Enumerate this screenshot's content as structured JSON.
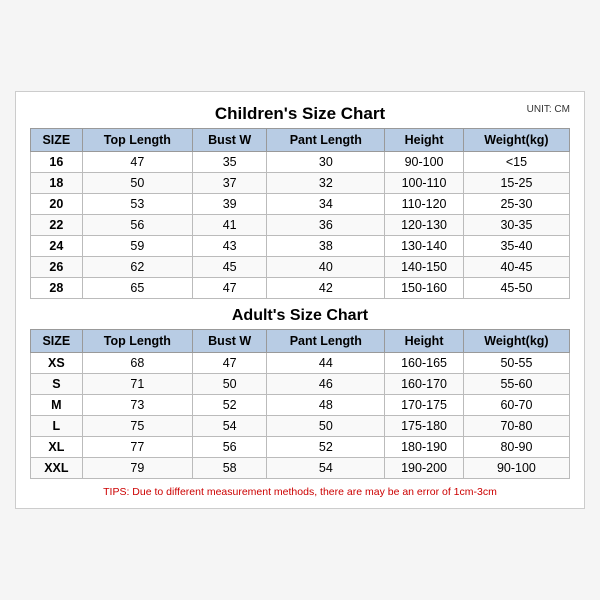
{
  "page": {
    "title": "Children's Size Chart",
    "unit": "UNIT: CM",
    "adult_title": "Adult's Size Chart",
    "tips": "TIPS: Due to different measurement methods, there are may be an error of 1cm-3cm",
    "headers": [
      "SIZE",
      "Top Length",
      "Bust W",
      "Pant Length",
      "Height",
      "Weight(kg)"
    ],
    "children_rows": [
      [
        "16",
        "47",
        "35",
        "30",
        "90-100",
        "<15"
      ],
      [
        "18",
        "50",
        "37",
        "32",
        "100-110",
        "15-25"
      ],
      [
        "20",
        "53",
        "39",
        "34",
        "110-120",
        "25-30"
      ],
      [
        "22",
        "56",
        "41",
        "36",
        "120-130",
        "30-35"
      ],
      [
        "24",
        "59",
        "43",
        "38",
        "130-140",
        "35-40"
      ],
      [
        "26",
        "62",
        "45",
        "40",
        "140-150",
        "40-45"
      ],
      [
        "28",
        "65",
        "47",
        "42",
        "150-160",
        "45-50"
      ]
    ],
    "adult_rows": [
      [
        "XS",
        "68",
        "47",
        "44",
        "160-165",
        "50-55"
      ],
      [
        "S",
        "71",
        "50",
        "46",
        "160-170",
        "55-60"
      ],
      [
        "M",
        "73",
        "52",
        "48",
        "170-175",
        "60-70"
      ],
      [
        "L",
        "75",
        "54",
        "50",
        "175-180",
        "70-80"
      ],
      [
        "XL",
        "77",
        "56",
        "52",
        "180-190",
        "80-90"
      ],
      [
        "XXL",
        "79",
        "58",
        "54",
        "190-200",
        "90-100"
      ]
    ]
  }
}
